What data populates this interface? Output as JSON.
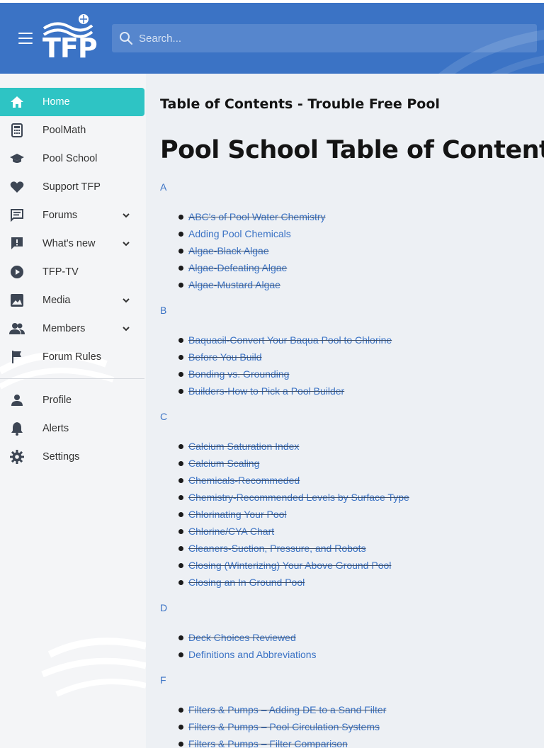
{
  "header": {
    "logo_text": "TFP",
    "search_placeholder": "Search..."
  },
  "sidebar": {
    "items": [
      {
        "label": "Home",
        "icon": "home-icon"
      },
      {
        "label": "PoolMath",
        "icon": "calculator-icon"
      },
      {
        "label": "Pool School",
        "icon": "graduation-cap-icon"
      },
      {
        "label": "Support TFP",
        "icon": "heart-icon"
      },
      {
        "label": "Forums",
        "icon": "forum-icon"
      },
      {
        "label": "What's new",
        "icon": "alert-message-icon"
      },
      {
        "label": "TFP-TV",
        "icon": "play-icon"
      },
      {
        "label": "Media",
        "icon": "image-icon"
      },
      {
        "label": "Members",
        "icon": "members-icon"
      },
      {
        "label": "Forum Rules",
        "icon": "flag-icon"
      },
      {
        "label": "Profile",
        "icon": "person-icon"
      },
      {
        "label": "Alerts",
        "icon": "bell-icon"
      },
      {
        "label": "Settings",
        "icon": "gear-icon"
      }
    ]
  },
  "main": {
    "subtitle": "Table of Contents - Trouble Free Pool",
    "title": "Pool School Table of Contents",
    "sections": [
      {
        "letter": "A",
        "items": [
          "ABC's of Pool Water Chemistry",
          "Adding Pool Chemicals",
          "Algae-Black Algae",
          "Algae-Defeating Algae",
          "Algae-Mustard Algae"
        ]
      },
      {
        "letter": "B",
        "items": [
          "Baquacil-Convert Your Baqua Pool to Chlorine",
          "Before You Build",
          "Bonding vs. Grounding",
          "Builders-How to Pick a Pool Builder"
        ]
      },
      {
        "letter": "C",
        "items": [
          "Calcium Saturation Index",
          "Calcium Scaling",
          "Chemicals-Recommeded",
          "Chemistry-Recommended Levels by Surface Type",
          "Chlorinating Your Pool",
          "Chlorine/CYA Chart",
          "Cleaners-Suction, Pressure, and Robots",
          "Closing (Winterizing) Your Above Ground Pool",
          "Closing an In Ground Pool"
        ]
      },
      {
        "letter": "D",
        "items": [
          "Deck Choices Reviewed",
          "Definitions and Abbreviations"
        ]
      },
      {
        "letter": "F",
        "items": [
          "Filters & Pumps – Adding DE to a Sand Filter",
          "Filters & Pumps – Pool Circulation Systems",
          "Filters & Pumps – Filter Comparison"
        ]
      }
    ]
  }
}
